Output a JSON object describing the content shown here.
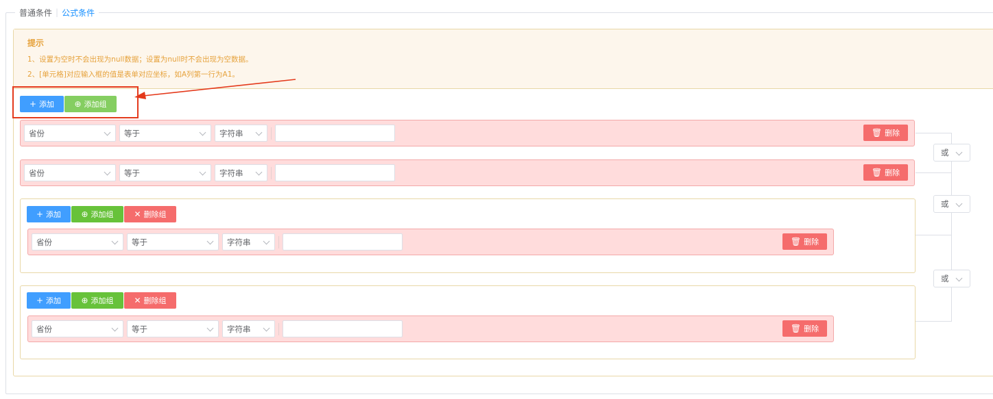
{
  "tabs": [
    "普通条件",
    "公式条件"
  ],
  "tip": {
    "title": "提示",
    "lines": [
      "1、设置为空时不会出现为null数据；设置为null时不会出现为空数据。",
      "2、[单元格]对应输入框的值是表单对应坐标，如A列第一行为A1。"
    ]
  },
  "buttons": {
    "add": "添加",
    "add_group": "添加组",
    "delete_group": "删除组",
    "delete": "删除"
  },
  "condition": {
    "field": "省份",
    "operator": "等于",
    "type": "字符串",
    "value": ""
  },
  "logic": [
    "或",
    "或",
    "或"
  ],
  "icons": {
    "add": "plus-icon",
    "add_group": "plus-circle-icon",
    "delete_group": "close-icon",
    "delete": "trash-icon",
    "select": "chevron-down-icon"
  },
  "colors": {
    "primary": "#409eff",
    "success": "#67c23a",
    "danger": "#f56c6c",
    "warning_text": "#e6a23c",
    "warning_bg": "#fdf6ec",
    "row_bg": "#ffdcdc",
    "highlight": "#e4391b"
  }
}
